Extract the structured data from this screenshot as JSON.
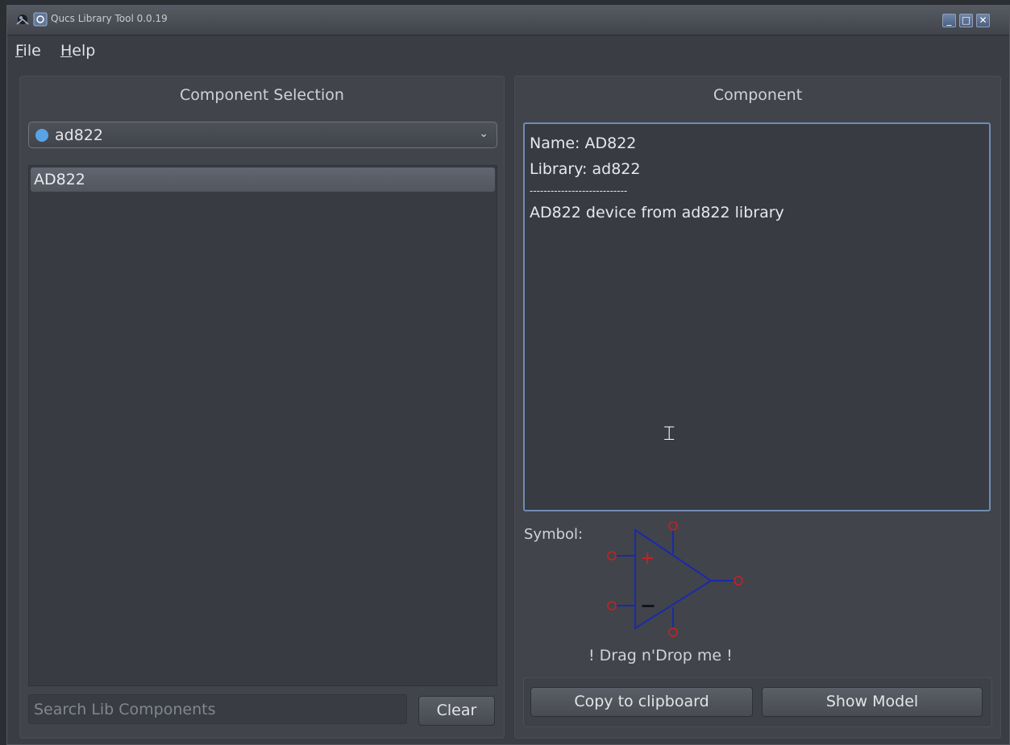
{
  "window": {
    "title": "Qucs Library Tool 0.0.19",
    "buttons": {
      "minimize": "_",
      "maximize": "□",
      "close": "✕"
    }
  },
  "menu": {
    "file": {
      "mnemonic": "F",
      "rest": "ile"
    },
    "help": {
      "mnemonic": "H",
      "rest": "elp"
    }
  },
  "left_panel": {
    "title": "Component Selection",
    "library_combo": {
      "icon": "home-icon",
      "value": "ad822"
    },
    "components": [
      {
        "label": "AD822",
        "selected": true
      }
    ],
    "search": {
      "placeholder": "Search Lib Components",
      "value": ""
    },
    "clear_label": "Clear"
  },
  "right_panel": {
    "title": "Component",
    "info": {
      "name_line": "Name: AD822",
      "library_line": "Library: ad822",
      "separator": "----------------------------",
      "description": "AD822 device from ad822 library"
    },
    "symbol_label": "Symbol:",
    "symbol_plus": "+",
    "symbol_minus": "−",
    "drag_label": "! Drag n'Drop me !",
    "copy_label": "Copy to clipboard",
    "show_model_label": "Show Model"
  },
  "colors": {
    "symbol_line": "#1a2aa8",
    "pin": "#cc2020",
    "focus_border": "#6e8db3"
  }
}
